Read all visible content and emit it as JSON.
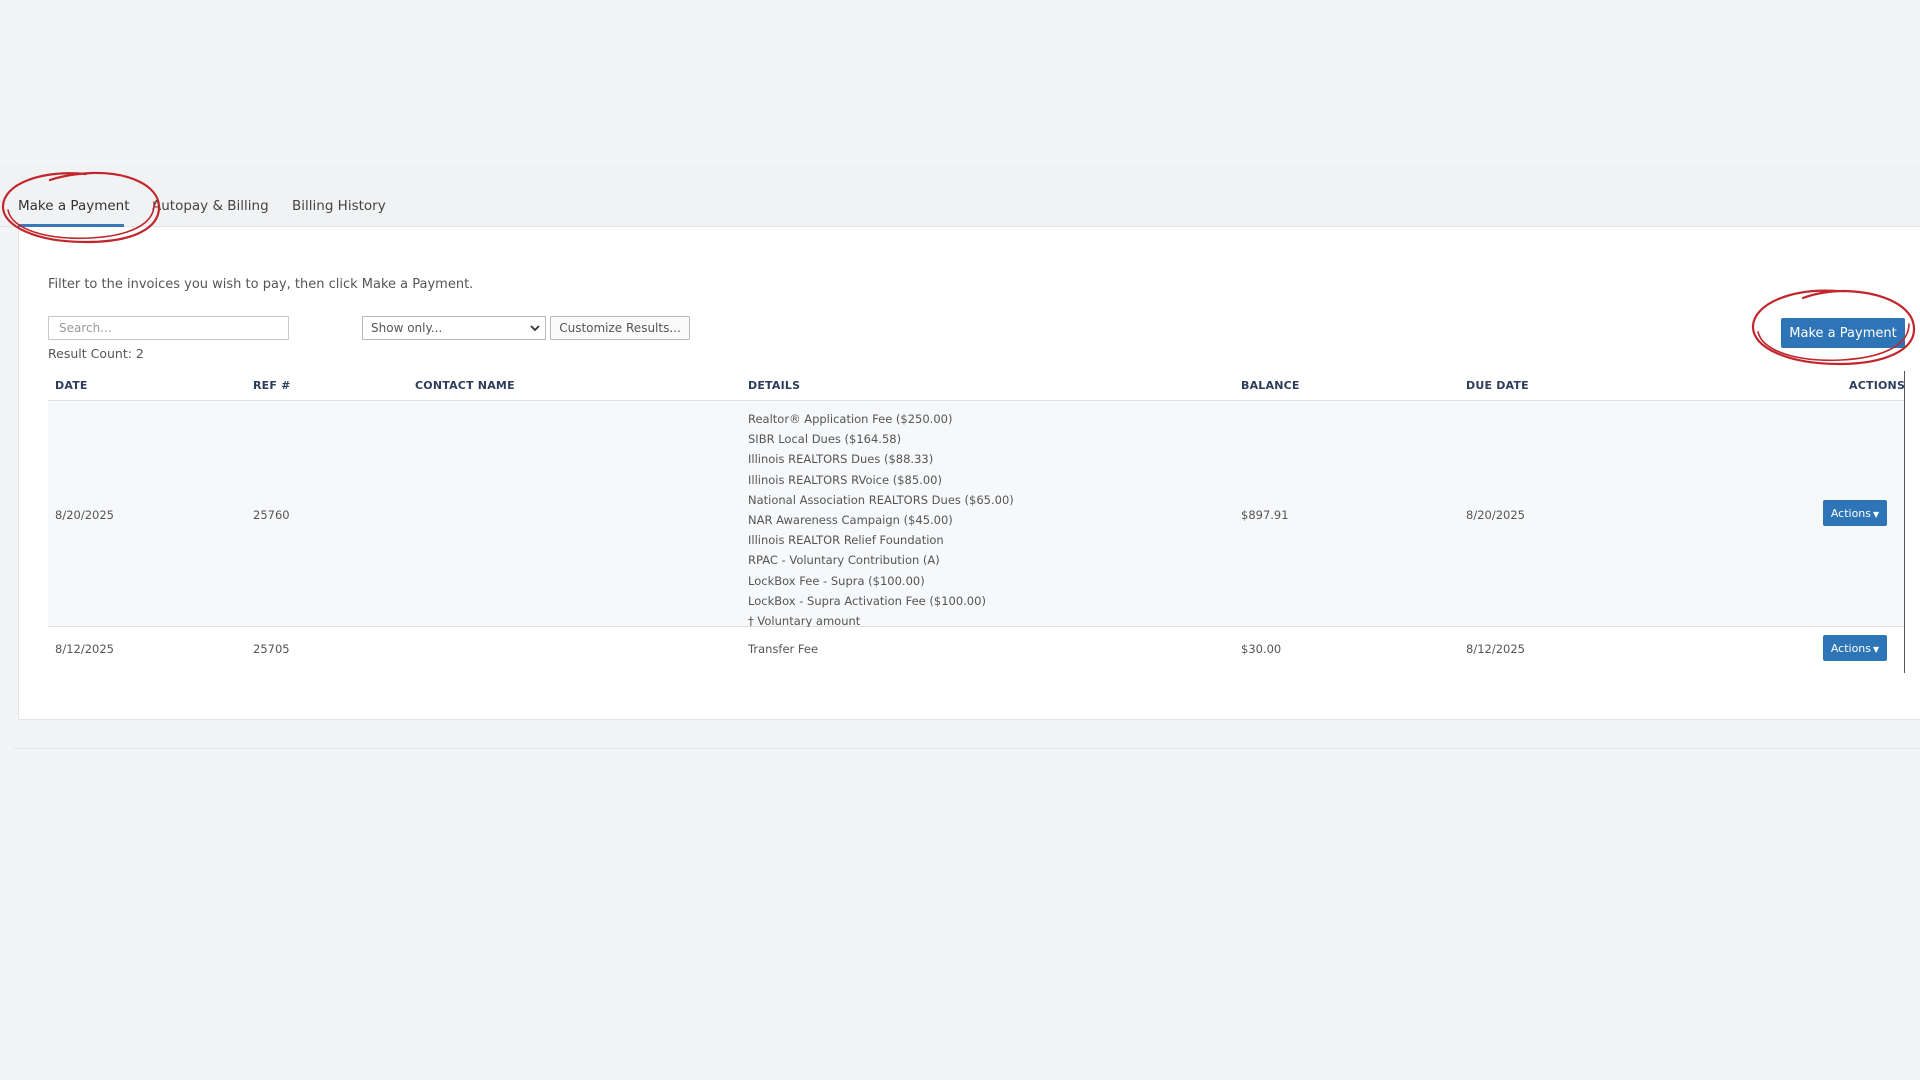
{
  "tabs": [
    {
      "label": "Make a Payment"
    },
    {
      "label": "Autopay & Billing"
    },
    {
      "label": "Billing History"
    }
  ],
  "instructions": "Filter to the invoices you wish to pay, then click Make a Payment.",
  "search": {
    "placeholder": "Search..."
  },
  "filter": {
    "selected": "Show only..."
  },
  "customize_label": "Customize Results...",
  "result_count": "Result Count: 2",
  "make_payment_label": "Make a Payment",
  "table": {
    "headers": [
      "DATE",
      "REF #",
      "CONTACT NAME",
      "DETAILS",
      "BALANCE",
      "DUE DATE",
      "ACTIONS"
    ],
    "rows": [
      {
        "date": "8/20/2025",
        "ref": "25760",
        "contact": "",
        "details": [
          "Realtor® Application Fee ($250.00)",
          "SIBR Local Dues ($164.58)",
          "Illinois REALTORS Dues ($88.33)",
          "Illinois REALTORS RVoice ($85.00)",
          "National Association REALTORS Dues ($65.00)",
          "NAR Awareness Campaign ($45.00)",
          "Illinois REALTOR Relief Foundation",
          "RPAC - Voluntary Contribution (A)",
          "LockBox Fee - Supra ($100.00)",
          "LockBox - Supra Activation Fee ($100.00)",
          "† Voluntary amount"
        ],
        "balance": "$897.91",
        "due_date": "8/20/2025",
        "action_label": "Actions"
      },
      {
        "date": "8/12/2025",
        "ref": "25705",
        "contact": "",
        "details": [
          "Transfer Fee"
        ],
        "balance": "$30.00",
        "due_date": "8/12/2025",
        "action_label": "Actions"
      }
    ]
  },
  "colors": {
    "accent": "#2e75b7",
    "annotation": "#c0262c"
  }
}
